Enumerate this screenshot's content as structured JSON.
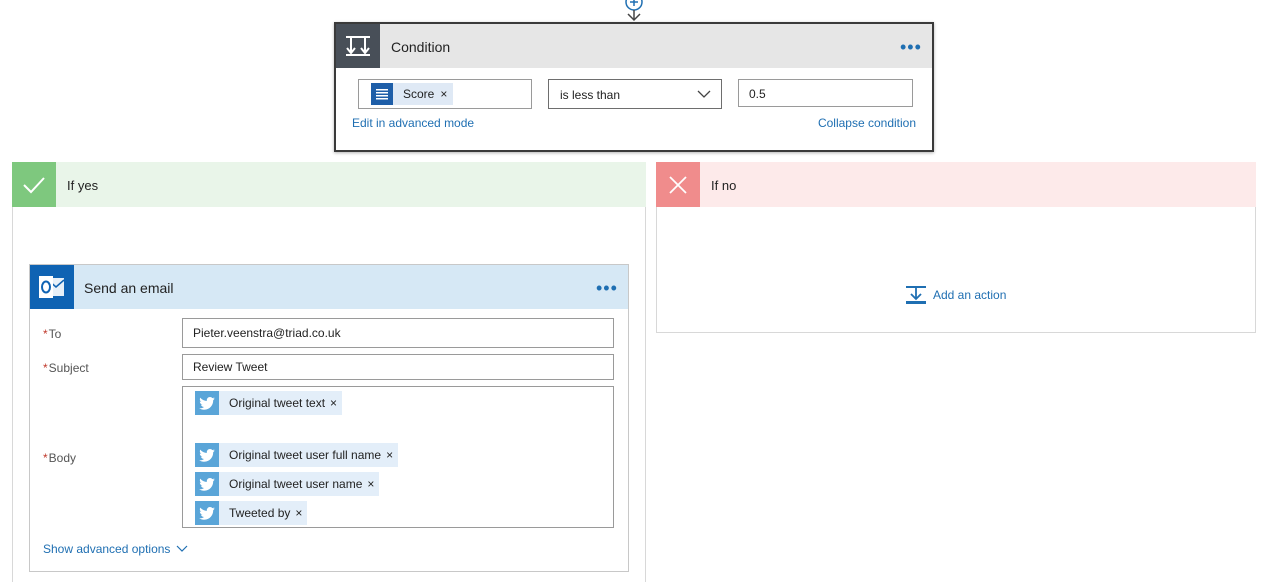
{
  "condition": {
    "title": "Condition",
    "more_label": "•••",
    "left_token": {
      "label": "Score",
      "remove": "×"
    },
    "operator": "is less than",
    "value": "0.5",
    "edit_advanced": "Edit in advanced mode",
    "collapse": "Collapse condition"
  },
  "if_yes": {
    "title": "If yes",
    "email": {
      "title": "Send an email",
      "more_label": "•••",
      "to_label": "To",
      "to_value": "Pieter.veenstra@triad.co.uk",
      "subject_label": "Subject",
      "subject_value": "Review Tweet",
      "body_label": "Body",
      "required_mark": "*",
      "body_tokens": [
        {
          "label": "Original tweet text",
          "remove": "×"
        },
        {
          "label": "Original tweet user full name",
          "remove": "×"
        },
        {
          "label": "Original tweet user name",
          "remove": "×"
        },
        {
          "label": "Tweeted by",
          "remove": "×"
        }
      ],
      "show_advanced": "Show advanced options"
    }
  },
  "if_no": {
    "title": "If no",
    "add_action": "Add an action"
  },
  "icons": {
    "condition": "condition-icon",
    "check": "check-icon",
    "cross": "cross-icon",
    "outlook": "outlook-icon",
    "twitter": "twitter-icon",
    "add_action": "add-action-icon",
    "chevron": "chevron-down-icon",
    "plus": "plus-circle-icon"
  },
  "colors": {
    "accent": "#1f6fb2",
    "yes_header": "#e9f5e9",
    "yes_icon": "#7ec87e",
    "no_header": "#fdeaea",
    "no_icon": "#f08c8c",
    "email_header": "#d6e8f5",
    "outlook_blue": "#0f63b3",
    "twitter_blue": "#5aa5d8"
  }
}
